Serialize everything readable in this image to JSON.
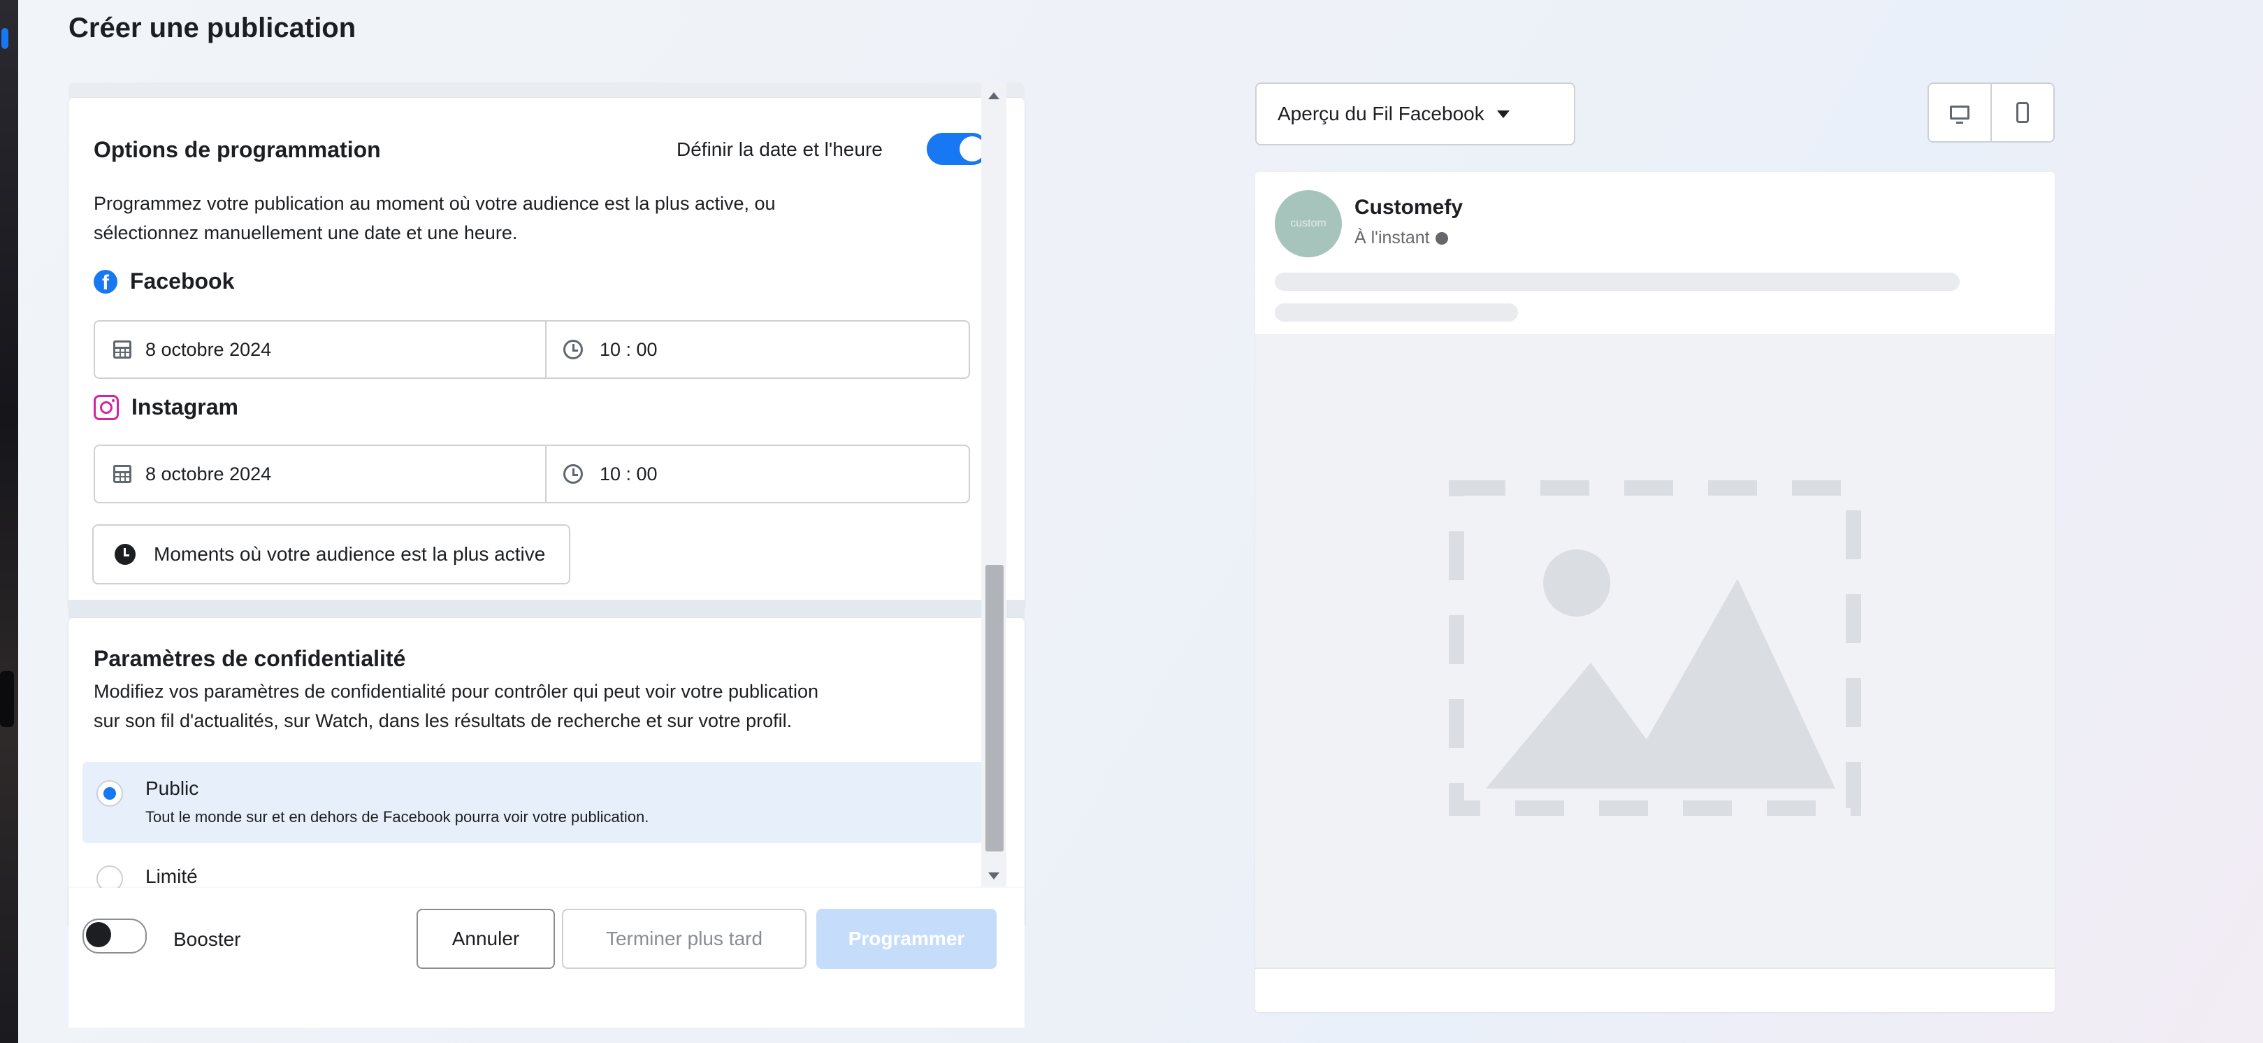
{
  "page": {
    "title": "Créer une publication"
  },
  "scheduling": {
    "title": "Options de programmation",
    "toggle_label": "Définir la date et l'heure",
    "toggle_on": true,
    "description_line1": "Programmez votre publication au moment où votre audience est la plus active, ou",
    "description_line2": "sélectionnez manuellement une date et une heure.",
    "platforms": [
      {
        "name": "Facebook",
        "date": "8 octobre 2024",
        "time": "10 : 00"
      },
      {
        "name": "Instagram",
        "date": "8 octobre 2024",
        "time": "10 : 00"
      }
    ],
    "audience_button": "Moments où votre audience est la plus active"
  },
  "privacy": {
    "title": "Paramètres de confidentialité",
    "description_line1": "Modifiez vos paramètres de confidentialité pour contrôler qui peut voir votre publication",
    "description_line2": "sur son fil d'actualités, sur Watch, dans les résultats de recherche et sur votre profil.",
    "options": [
      {
        "label": "Public",
        "sub": "Tout le monde sur et en dehors de Facebook pourra voir votre publication.",
        "selected": true
      },
      {
        "label": "Limité",
        "sub": "",
        "selected": false
      }
    ]
  },
  "footer": {
    "boost_label": "Booster",
    "boost_on": false,
    "cancel_label": "Annuler",
    "later_label": "Terminer plus tard",
    "schedule_label": "Programmer"
  },
  "preview": {
    "dropdown_label": "Aperçu du Fil Facebook",
    "page_name": "Customefy",
    "avatar_text": "custom",
    "time_label": "À l'instant",
    "icons": [
      "desktop-icon",
      "mobile-icon",
      "globe-icon",
      "image-placeholder-icon"
    ]
  },
  "colors": {
    "accent": "#1877f2",
    "schedule_disabled": "#c5dcfa",
    "selected_bg": "#e7f0fa"
  }
}
